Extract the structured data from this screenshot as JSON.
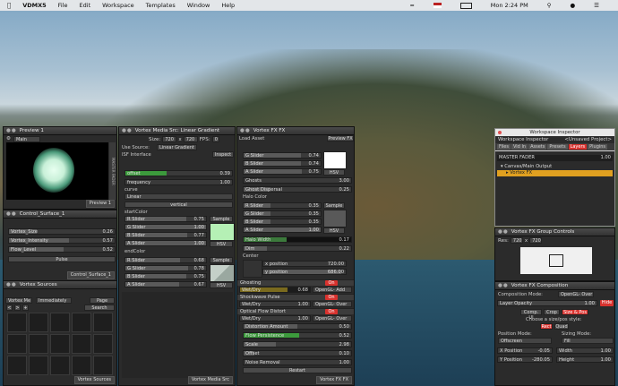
{
  "menubar": {
    "app": "VDMX5",
    "items": [
      "File",
      "Edit",
      "Workspace",
      "Templates",
      "Window",
      "Help"
    ],
    "clock": "Mon 2:24 PM"
  },
  "preview": {
    "title": "Preview 1",
    "source": "Main Output",
    "footer": "Preview 1"
  },
  "control_surface": {
    "title": "Control_Surface_1",
    "sliders": [
      {
        "label": "Vortex_Size",
        "value": "0.26",
        "level": 0.26
      },
      {
        "label": "Vortex_Intensity",
        "value": "0.57",
        "level": 0.57
      },
      {
        "label": "Flow_Level",
        "value": "0.52",
        "level": 0.52
      }
    ],
    "pulse": "Pulse",
    "footer": "Control_Surface_1"
  },
  "vortex_sources": {
    "title": "Vortex Sources",
    "tabs": [
      "Vortex Me",
      "Immediately",
      "Page"
    ],
    "search": "Search",
    "footer": "Vortex Sources"
  },
  "media_src": {
    "title": "Vortex Media Src: Linear Gradient",
    "size_label": "Size:",
    "w": "720",
    "x": "x",
    "h": "720",
    "fps_label": "FPS:",
    "fps": "0",
    "use_source": "Use Source:",
    "source": "Linear Gradient",
    "isf": "ISF Interface",
    "inspect": "Inspect",
    "offset": {
      "label": "offset",
      "value": "0.39",
      "level": 0.39
    },
    "frequency": {
      "label": "frequency",
      "value": "1.00"
    },
    "curve_label": "curve",
    "curve": "Linear",
    "vertical": "vertical",
    "startColor": "startColor",
    "start": [
      {
        "label": "R Slider",
        "value": "0.75",
        "level": 0.75
      },
      {
        "label": "G Slider",
        "value": "1.00",
        "level": 1.0
      },
      {
        "label": "B Slider",
        "value": "0.77",
        "level": 0.77
      },
      {
        "label": "A Slider",
        "value": "1.00",
        "level": 1.0
      }
    ],
    "endColor": "endColor",
    "end": [
      {
        "label": "R Slider",
        "value": "0.68",
        "level": 0.68
      },
      {
        "label": "G Slider",
        "value": "0.78",
        "level": 0.78
      },
      {
        "label": "B Slider",
        "value": "0.75",
        "level": 0.75
      },
      {
        "label": "A Slider",
        "value": "0.67",
        "level": 0.67
      }
    ],
    "sample": "Sample",
    "hsv": "HSV",
    "startswatch": "#b5f0b5",
    "endswatch": "#c4d0c8",
    "footer": "Vortex Media Src"
  },
  "fx": {
    "title": "Vortex FX FX",
    "load": "Load Asset",
    "preview": "Preview FX",
    "rows1": [
      {
        "label": "G Slider",
        "value": "0.74",
        "level": 0.74
      },
      {
        "label": "B Slider",
        "value": "0.74",
        "level": 0.74
      },
      {
        "label": "A Slider",
        "value": "0.75",
        "level": 0.75
      }
    ],
    "ghosts": {
      "label": "Ghosts",
      "value": "3.00"
    },
    "dispersal": {
      "label": "Ghost Dispersal",
      "value": "0.25"
    },
    "halo_color": "Halo Color",
    "rows2": [
      {
        "label": "R Slider",
        "value": "0.35",
        "level": 0.35
      },
      {
        "label": "G Slider",
        "value": "0.35",
        "level": 0.35
      },
      {
        "label": "B Slider",
        "value": "0.35",
        "level": 0.35
      },
      {
        "label": "A Slider",
        "value": "1.00",
        "level": 1.0
      }
    ],
    "halo_width": {
      "label": "Halo Width",
      "value": "0.17"
    },
    "dim": {
      "label": "Dim",
      "value": "0.22"
    },
    "center": "Center",
    "xpos": {
      "label": "x position",
      "value": "720.00"
    },
    "ypos": {
      "label": "y position",
      "value": "686.00"
    },
    "ghosting": "Ghosting",
    "on": "On",
    "wetdry": "Wet/Dry",
    "wd1": "0.68",
    "mode": "OpenGL- Add",
    "shockwave": "Shockwave Pulse",
    "wd2": "1.00",
    "mode2": "OpenGL- Over",
    "optical": "Optical Flow Distort",
    "wd3": "1.00",
    "mode3": "OpenGL- Over",
    "distortion": {
      "label": "Distortion Amount",
      "value": "0.50"
    },
    "persistence": {
      "label": "Flow Persistence",
      "value": "0.52"
    },
    "scale": {
      "label": "Scale",
      "value": "2.98"
    },
    "offset": {
      "label": "Offset",
      "value": "0.10"
    },
    "noise": {
      "label": "Noise Removal",
      "value": "1.00"
    },
    "restart": "Restart",
    "footer": "Vortex FX FX"
  },
  "inspector": {
    "window": "Workspace Inspector",
    "title": "Workspace Inspector",
    "unsaved": "<Unsaved Project>",
    "tabs": [
      "Files",
      "Vid In",
      "Assets",
      "Presets",
      "Layers",
      "Plugins"
    ],
    "active_tab": "Layers",
    "master": "MASTER FADER",
    "master_val": "1.00",
    "canvas": "Canvas/Main Output",
    "layer": "Vortex FX"
  },
  "group_controls": {
    "title": "Vortex FX Group Controls",
    "res": "Res:",
    "w": "720",
    "x": "x",
    "h": "720"
  },
  "composition": {
    "title": "Vortex FX Composition",
    "mode_label": "Composition Mode:",
    "mode": "OpenGL- Over",
    "opacity_label": "Layer Opacity",
    "opacity": "1.00",
    "hide": "Hide",
    "btns": [
      "Comp. UI",
      "Crop",
      "Size & Pos"
    ],
    "sizepos_hint": "Choose a size/pos style:",
    "rect": "Rect",
    "quad": "Quad",
    "pos_mode": "Position Mode:",
    "pos_val": "Offscreen",
    "sizing_mode": "Sizing Mode:",
    "sizing_val": "Fill",
    "xpos": {
      "label": "X Position",
      "value": "-0.05"
    },
    "ypos": {
      "label": "Y Position",
      "value": "-280.05"
    },
    "width": {
      "label": "Width",
      "value": "1.00"
    },
    "height": {
      "label": "Height",
      "value": "1.00"
    }
  }
}
